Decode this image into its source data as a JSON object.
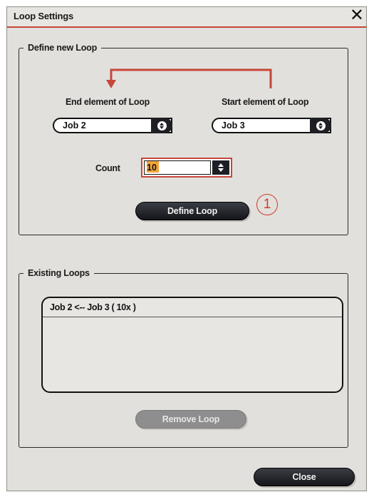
{
  "window": {
    "title": "Loop Settings",
    "close_glyph": "✕"
  },
  "define_group": {
    "legend": "Define new Loop",
    "end_label": "End element of Loop",
    "start_label": "Start element of Loop",
    "end_value": "Job 2",
    "start_value": "Job 3",
    "count_label": "Count",
    "count_value": "10",
    "define_button": "Define Loop",
    "callout": "1"
  },
  "existing_group": {
    "legend": "Existing Loops",
    "items": [
      "Job 2 <-- Job 3 ( 10x )"
    ],
    "remove_button": "Remove Loop"
  },
  "footer": {
    "close_button": "Close"
  },
  "colors": {
    "accent_red": "#c8463a",
    "dark_button": "#1e1f24",
    "selection": "#f2a53c"
  },
  "icons": [
    "close-icon",
    "loop-arrow-icon",
    "updown-arrows-icon",
    "spinner-icon"
  ]
}
